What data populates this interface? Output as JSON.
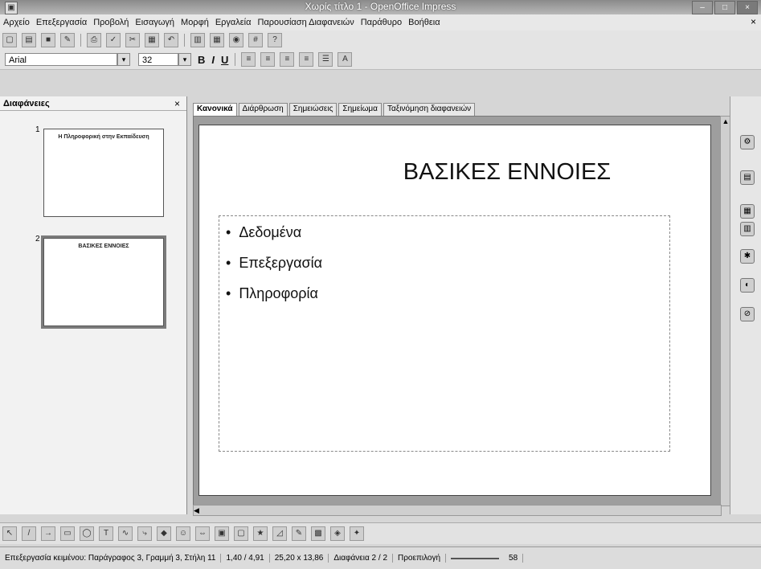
{
  "window": {
    "title": "Χωρίς τίτλο 1 - OpenOffice Impress",
    "minimize": "–",
    "maximize": "□",
    "close": "×"
  },
  "menu": [
    "Αρχείο",
    "Επεξεργασία",
    "Προβολή",
    "Εισαγωγή",
    "Μορφή",
    "Εργαλεία",
    "Παρουσίαση Διαφανειών",
    "Παράθυρο",
    "Βοήθεια"
  ],
  "menu_close": "×",
  "formatting": {
    "font_name": "Arial",
    "font_size": "32",
    "bold": "B",
    "italic": "I",
    "underline": "U"
  },
  "slides_pane": {
    "title": "Διαφάνειες",
    "close": "×",
    "slides": [
      {
        "number": "1",
        "title": "Η Πληροφορική στην Εκπαίδευση"
      },
      {
        "number": "2",
        "title": "ΒΑΣΙΚΕΣ ΕΝΝΟΙΕΣ"
      }
    ]
  },
  "view_tabs": [
    "Κανονικά",
    "Διάρθρωση",
    "Σημειώσεις",
    "Σημείωμα",
    "Ταξινόμηση διαφανειών"
  ],
  "slide": {
    "title": "ΒΑΣΙΚΕΣ ΕΝΝΟΙΕΣ",
    "bullets": [
      "Δεδομένα",
      "Επεξεργασία",
      "Πληροφορία"
    ]
  },
  "status": {
    "mode": "Επεξεργασία κειμένου: Παράγραφος 3, Γραμμή 3, Στήλη 11",
    "position": "1,40 / 4,91",
    "size": "25,20 x 13,86",
    "slide": "Διαφάνεια 2 / 2",
    "layout": "Προεπιλογή",
    "zoom": "58"
  }
}
